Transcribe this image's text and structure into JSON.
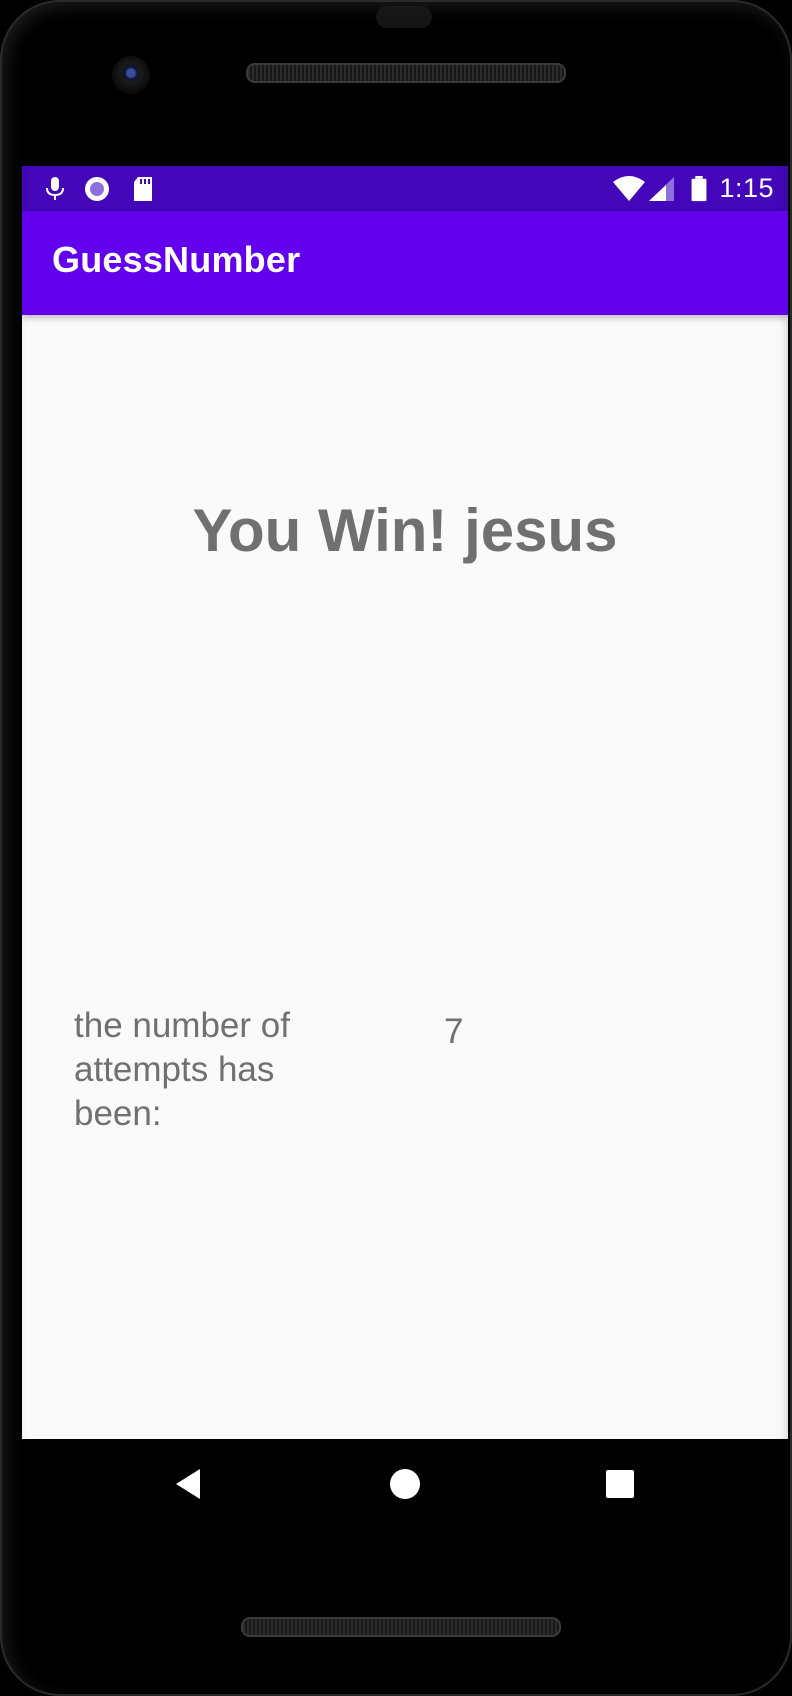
{
  "status_bar": {
    "time": "1:15",
    "left_icons": [
      "mic-icon",
      "record-icon",
      "sd-card-icon"
    ],
    "right_icons": [
      "wifi-icon",
      "signal-icon",
      "battery-icon"
    ]
  },
  "app_bar": {
    "title": "GuessNumber"
  },
  "content": {
    "win_message": "You Win! jesus",
    "attempts_label": "the number of attempts has been:",
    "attempts_value": "7"
  },
  "nav_bar": {
    "buttons": [
      "back-icon",
      "home-icon",
      "recents-icon"
    ]
  },
  "colors": {
    "status_bar": "#4306b8",
    "app_bar": "#6200ee",
    "background": "#fafafa",
    "text": "#707070"
  }
}
